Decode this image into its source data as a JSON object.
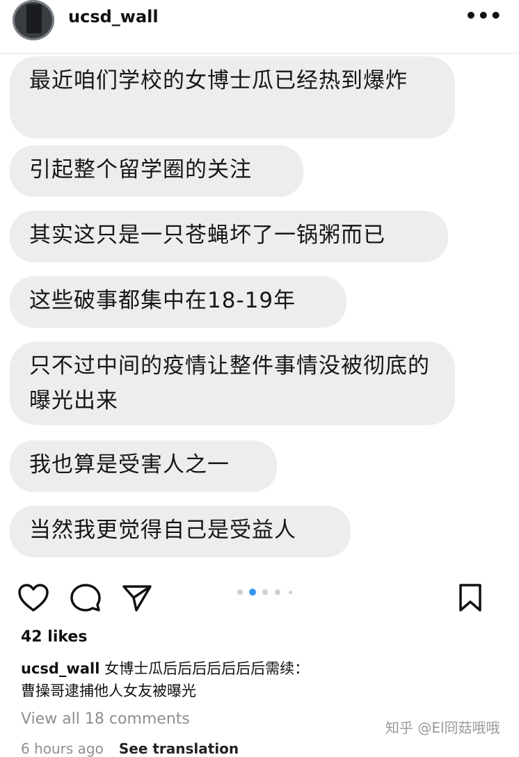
{
  "header": {
    "username": "ucsd_wall",
    "more_icon": "ellipsis-icon",
    "more_glyph": "•••"
  },
  "post": {
    "messages": [
      "最近咱们学校的女博士瓜已经热到爆炸",
      "引起整个留学圈的关注",
      "其实这只是一只苍蝇坏了一锅粥而已",
      "这些破事都集中在18-19年",
      "只不过中间的疫情让整件事情没被彻底的曝光出来",
      "我也算是受害人之一",
      "当然我更觉得自己是受益人"
    ],
    "carousel": {
      "count": 5,
      "active_index": 1
    }
  },
  "actions": {
    "like_icon": "heart-icon",
    "comment_icon": "comment-icon",
    "share_icon": "send-icon",
    "save_icon": "bookmark-icon"
  },
  "likes": "42 likes",
  "caption": {
    "user": "ucsd_wall",
    "text": "女博士瓜后后后后后后后需续：",
    "line2": "曹操哥逮捕他人女友被曝光"
  },
  "view_comments": "View all 18 comments",
  "time_ago": "6 hours ago",
  "see_translation": "See translation",
  "watermark": "知乎 @El冏菇哦哦",
  "colors": {
    "bubble": "#ededed",
    "active_dot": "#3897f0",
    "muted_text": "#8e8e8e"
  }
}
